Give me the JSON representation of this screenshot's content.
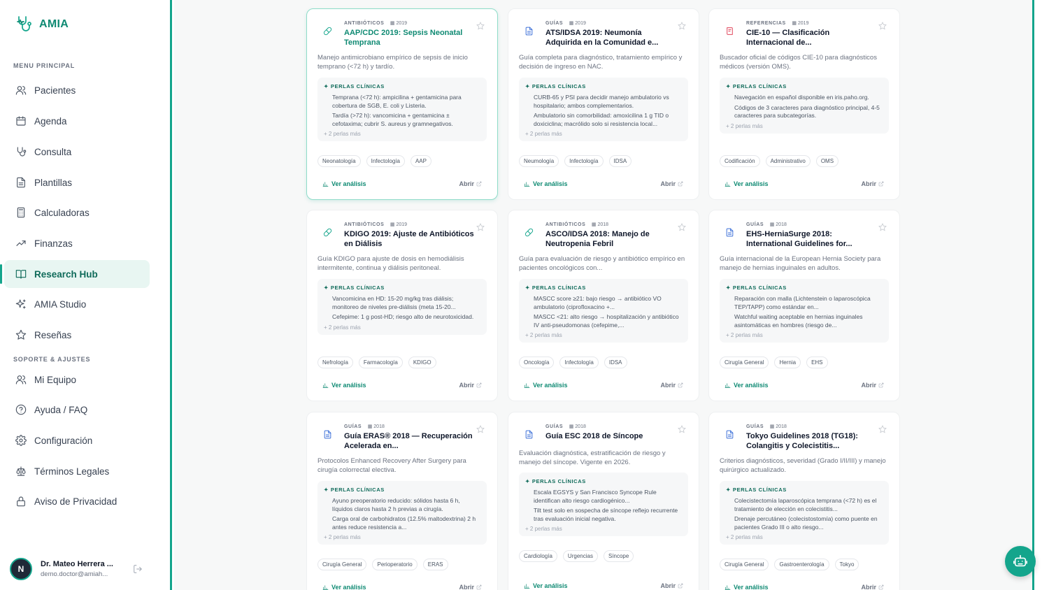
{
  "app": {
    "name": "AMIA"
  },
  "sidebar": {
    "main_label": "MENU PRINCIPAL",
    "support_label": "SOPORTE & AJUSTES",
    "items": [
      {
        "label": "Pacientes",
        "icon": "users-icon"
      },
      {
        "label": "Agenda",
        "icon": "calendar-icon"
      },
      {
        "label": "Consulta",
        "icon": "stethoscope-icon"
      },
      {
        "label": "Plantillas",
        "icon": "document-icon"
      },
      {
        "label": "Calculadoras",
        "icon": "calculator-icon"
      },
      {
        "label": "Finanzas",
        "icon": "trend-icon"
      },
      {
        "label": "Research Hub",
        "icon": "book-open-icon",
        "active": true
      },
      {
        "label": "AMIA Studio",
        "icon": "sparkles-icon"
      },
      {
        "label": "Reseñas",
        "icon": "star-icon"
      }
    ],
    "support_items": [
      {
        "label": "Mi Equipo",
        "icon": "team-icon"
      },
      {
        "label": "Ayuda / FAQ",
        "icon": "help-icon"
      },
      {
        "label": "Configuración",
        "icon": "gear-icon"
      },
      {
        "label": "Términos Legales",
        "icon": "scale-icon"
      },
      {
        "label": "Aviso de Privacidad",
        "icon": "lock-icon"
      }
    ],
    "user": {
      "initial": "N",
      "name": "Dr. Mateo Herrera ...",
      "email": "demo.doctor@amiah..."
    }
  },
  "labels": {
    "pearls_header": "PERLAS CLÍNICAS",
    "more_pearls": "+ 2 perlas más",
    "ver_analisis": "Ver análisis",
    "abrir": "Abrir"
  },
  "cards": [
    {
      "category": "ANTIBIÓTICOS",
      "year": "2019",
      "kind": "antibiotic",
      "title": "AAP/CDC 2019: Sepsis Neonatal Temprana",
      "description": "Manejo antimicrobiano empírico de sepsis de inicio temprano (<72 h) y tardío.",
      "pearls": [
        "Temprana (<72 h): ampicilina + gentamicina para cobertura de SGB, E. coli y Listeria.",
        "Tardía (>72 h): vancomicina + gentamicina ± cefotaxima; cubrir S. aureus y gramnegativos."
      ],
      "tags": [
        "Neonatología",
        "Infectología",
        "AAP"
      ]
    },
    {
      "category": "GUÍAS",
      "year": "2019",
      "kind": "guide",
      "title": "ATS/IDSA 2019: Neumonía Adquirida en la Comunidad e...",
      "description": "Guía completa para diagnóstico, tratamiento empírico y decisión de ingreso en NAC.",
      "pearls": [
        "CURB-65 y PSI para decidir manejo ambulatorio vs hospitalario; ambos complementarios.",
        "Ambulatorio sin comorbilidad: amoxicilina 1 g TID o doxiciclina; macrólido solo si resistencia local..."
      ],
      "tags": [
        "Neumología",
        "Infectología",
        "IDSA"
      ]
    },
    {
      "category": "REFERENCIAS",
      "year": "2019",
      "kind": "reference",
      "title": "CIE-10 — Clasificación Internacional de...",
      "description": "Buscador oficial de códigos CIE-10 para diagnósticos médicos (versión OMS).",
      "pearls": [
        "Navegación en español disponible en iris.paho.org.",
        "Códigos de 3 caracteres para diagnóstico principal, 4-5 caracteres para subcategorías."
      ],
      "tags": [
        "Codificación",
        "Administrativo",
        "OMS"
      ]
    },
    {
      "category": "ANTIBIÓTICOS",
      "year": "2019",
      "kind": "antibiotic",
      "title": "KDIGO 2019: Ajuste de Antibióticos en Diálisis",
      "description": "Guía KDIGO para ajuste de dosis en hemodiálisis intermitente, continua y diálisis peritoneal.",
      "pearls": [
        "Vancomicina en HD: 15-20 mg/kg tras diálisis; monitoreo de niveles pre-diálisis (meta 15-20...",
        "Cefepime: 1 g post-HD; riesgo alto de neurotoxicidad."
      ],
      "tags": [
        "Nefrología",
        "Farmacología",
        "KDIGO"
      ]
    },
    {
      "category": "ANTIBIÓTICOS",
      "year": "2018",
      "kind": "antibiotic",
      "title": "ASCO/IDSA 2018: Manejo de Neutropenia Febril",
      "description": "Guía para evaluación de riesgo y antibiótico empírico en pacientes oncológicos con...",
      "pearls": [
        "MASCC score ≥21: bajo riesgo → antibiótico VO ambulatorio (ciprofloxacino +...",
        "MASCC <21: alto riesgo → hospitalización y antibiótico IV anti-pseudomonas (cefepime,..."
      ],
      "tags": [
        "Oncología",
        "Infectología",
        "IDSA"
      ]
    },
    {
      "category": "GUÍAS",
      "year": "2018",
      "kind": "guide",
      "title": "EHS-HerniaSurge 2018: International Guidelines for...",
      "description": "Guía internacional de la European Hernia Society para manejo de hernias inguinales en adultos.",
      "pearls": [
        "Reparación con malla (Lichtenstein o laparoscópica TEP/TAPP) como estándar en...",
        "Watchful waiting aceptable en hernias inguinales asintomáticas en hombres (riesgo de..."
      ],
      "tags": [
        "Cirugía General",
        "Hernia",
        "EHS"
      ]
    },
    {
      "category": "GUÍAS",
      "year": "2018",
      "kind": "guide",
      "title": "Guía ERAS® 2018 — Recuperación Acelerada en...",
      "description": "Protocolos Enhanced Recovery After Surgery para cirugía colorrectal electiva.",
      "pearls": [
        "Ayuno preoperatorio reducido: sólidos hasta 6 h, líquidos claros hasta 2 h previas a cirugía.",
        "Carga oral de carbohidratos (12.5% maltodextrina) 2 h antes reduce resistencia a..."
      ],
      "tags": [
        "Cirugía General",
        "Perioperatorio",
        "ERAS"
      ]
    },
    {
      "category": "GUÍAS",
      "year": "2018",
      "kind": "guide",
      "title": "Guía ESC 2018 de Síncope",
      "description": "Evaluación diagnóstica, estratificación de riesgo y manejo del síncope. Vigente en 2026.",
      "pearls": [
        "Escala EGSYS y San Francisco Syncope Rule identifican alto riesgo cardiogénico...",
        "Tilt test solo en sospecha de síncope reflejo recurrente tras evaluación inicial negativa."
      ],
      "tags": [
        "Cardiología",
        "Urgencias",
        "Síncope"
      ]
    },
    {
      "category": "GUÍAS",
      "year": "2018",
      "kind": "guide",
      "title": "Tokyo Guidelines 2018 (TG18): Colangitis y Colecistitis...",
      "description": "Criterios diagnósticos, severidad (Grado I/II/III) y manejo quirúrgico actualizado.",
      "pearls": [
        "Colecistectomía laparoscópica temprana (<72 h) es el tratamiento de elección en colecistitis...",
        "Drenaje percutáneo (colecistostomía) como puente en pacientes Grado III o alto riesgo..."
      ],
      "tags": [
        "Cirugía General",
        "Gastroenterología",
        "Tokyo"
      ]
    }
  ],
  "colors": {
    "accent": "#14a58c",
    "accent_dark": "#0f8a73",
    "antibiotic": "#14a58c",
    "guide": "#3b6fd8",
    "reference": "#e0445a"
  }
}
